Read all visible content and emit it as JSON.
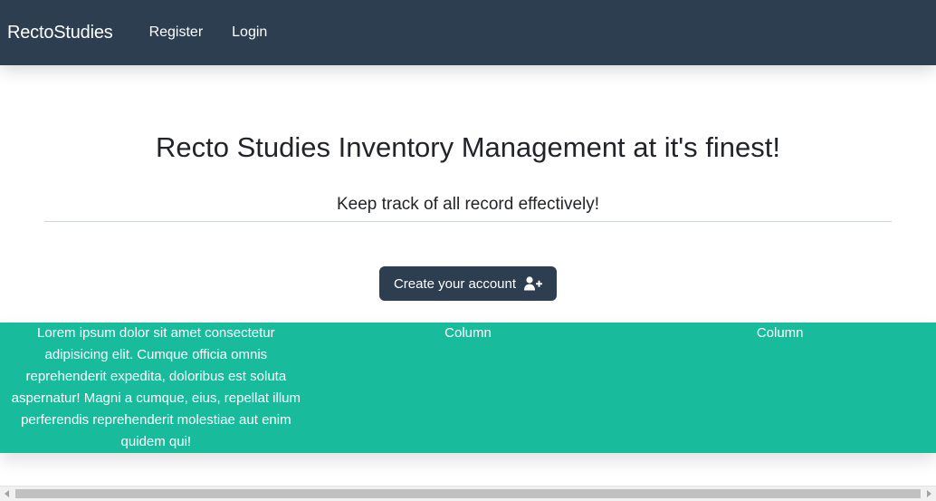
{
  "navbar": {
    "brand": "RectoStudies",
    "links": [
      "Register",
      "Login"
    ],
    "background": "#2c3e50"
  },
  "hero": {
    "title": "Recto Studies Inventory Management at it's finest!",
    "lead": "Keep track of all record effectively!",
    "cta": {
      "label": "Create your account",
      "icon": "user-plus-icon"
    }
  },
  "band": {
    "background": "#18bc9c",
    "columns": [
      "Lorem ipsum dolor sit amet consectetur adipisicing elit. Cumque officia omnis reprehenderit expedita, doloribus est soluta aspernatur! Magni a cumque, eius, repellat illum perferendis reprehenderit molestiae aut enim quidem qui!",
      "Column",
      "Column"
    ]
  }
}
